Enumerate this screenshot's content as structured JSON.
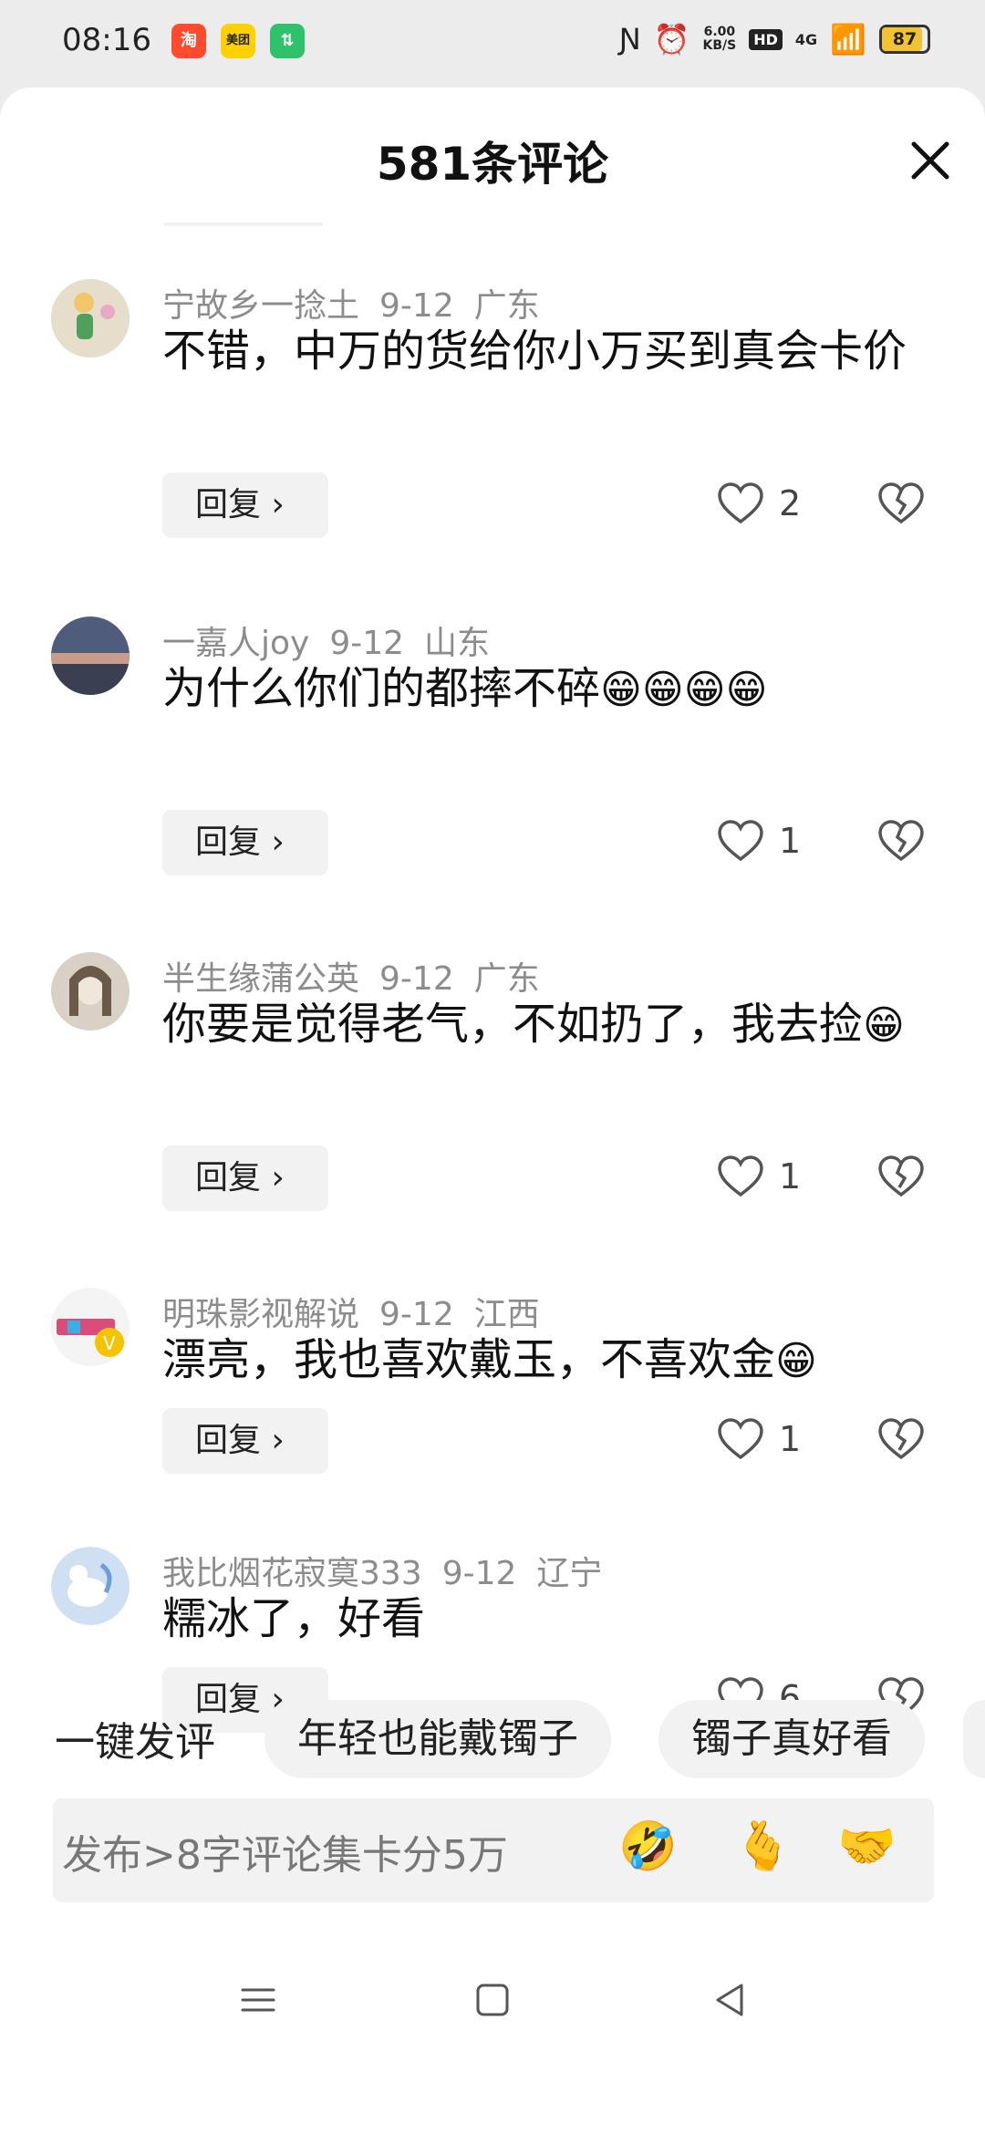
{
  "status": {
    "time": "08:16",
    "apps": [
      {
        "name": "taobao-icon",
        "text": "淘",
        "color": "#ff4a2d"
      },
      {
        "name": "meituan-icon",
        "text": "美团",
        "color": "#ffd100"
      },
      {
        "name": "transfer-icon",
        "text": "⇅",
        "color": "#2ec26a"
      }
    ],
    "net_speed": "6.00",
    "net_unit": "KB/S",
    "hd": "HD",
    "signal": "4G",
    "battery": "87",
    "battery_level": 0.87
  },
  "header": {
    "title": "581条评论"
  },
  "comments": [
    {
      "user": "宁故乡一捻土",
      "date": "9-12",
      "location": "广东",
      "text": "不错，中万的货给你小万买到真会卡价",
      "emoji": "",
      "likes": "2",
      "reply": "回复 ›",
      "avatar_color": "#c9b79a"
    },
    {
      "user": "一嘉人joy",
      "date": "9-12",
      "location": "山东",
      "text": "为什么你们的都摔不碎",
      "emoji": "😁😁😁😁",
      "likes": "1",
      "reply": "回复 ›",
      "avatar_color": "#5d6b8a"
    },
    {
      "user": "半生缘蒲公英",
      "date": "9-12",
      "location": "广东",
      "text": "你要是觉得老气，不如扔了，我去捡",
      "emoji": "😁",
      "likes": "1",
      "reply": "回复 ›",
      "avatar_color": "#b8aa9a"
    },
    {
      "user": "明珠影视解说",
      "date": "9-12",
      "location": "江西",
      "text": "漂亮，我也喜欢戴玉，不喜欢金",
      "emoji": "😁",
      "likes": "1",
      "reply": "回复 ›",
      "avatar_color": "#f0f0f0"
    },
    {
      "user": "我比烟花寂寞333",
      "date": "9-12",
      "location": "辽宁",
      "text": "糯冰了，好看",
      "emoji": "",
      "likes": "6",
      "reply": "回复 ›",
      "avatar_color": "#a9c6e6"
    }
  ],
  "quick_comment": {
    "label": "一键发评",
    "chips": [
      "年轻也能戴镯子",
      "镯子真好看"
    ]
  },
  "input": {
    "placeholder": "发布>8字评论集卡分5万",
    "emojis": [
      "🤣",
      "🫰",
      "🤝"
    ]
  }
}
